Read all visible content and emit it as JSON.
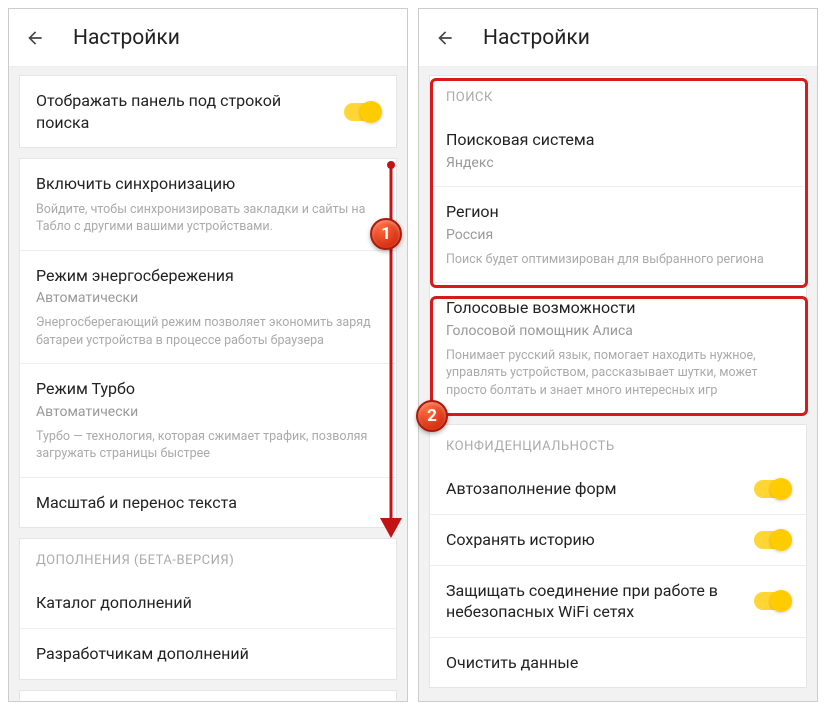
{
  "left": {
    "title": "Настройки",
    "panel_row": "Отображать панель под строкой поиска",
    "sync": {
      "title": "Включить синхронизацию",
      "desc": "Войдите, чтобы синхронизировать закладки и сайты на Табло с другими вашими устройствами."
    },
    "power": {
      "title": "Режим энергосбережения",
      "sub": "Автоматически",
      "desc": "Энергосберегающий режим позволяет экономить заряд батареи устройства в процессе работы браузера"
    },
    "turbo": {
      "title": "Режим Турбо",
      "sub": "Автоматически",
      "desc": "Турбо — технология, которая сжимает трафик, позволяя загружать страницы быстрее"
    },
    "scale": "Масштаб и перенос текста",
    "addons_header": "ДОПОЛНЕНИЯ (БЕТА-ВЕРСИЯ)",
    "catalog": "Каталог дополнений",
    "devs": "Разработчикам дополнений"
  },
  "right": {
    "title": "Настройки",
    "search_header": "ПОИСК",
    "engine": {
      "title": "Поисковая система",
      "sub": "Яндекс"
    },
    "region": {
      "title": "Регион",
      "sub": "Россия",
      "desc": "Поиск будет оптимизирован для выбранного региона"
    },
    "voice": {
      "title": "Голосовые возможности",
      "sub": "Голосовой помощник Алиса",
      "desc": "Понимает русский язык, помогает находить нужное, управлять устройством, рассказывает шутки, может просто болтать и знает много интересных игр"
    },
    "privacy_header": "КОНФИДЕНЦИАЛЬНОСТЬ",
    "autofill": "Автозаполнение форм",
    "history": "Сохранять историю",
    "wifi": "Защищать соединение при работе в небезопасных WiFi сетях",
    "clear": "Очистить данные"
  },
  "badges": {
    "one": "1",
    "two": "2"
  }
}
